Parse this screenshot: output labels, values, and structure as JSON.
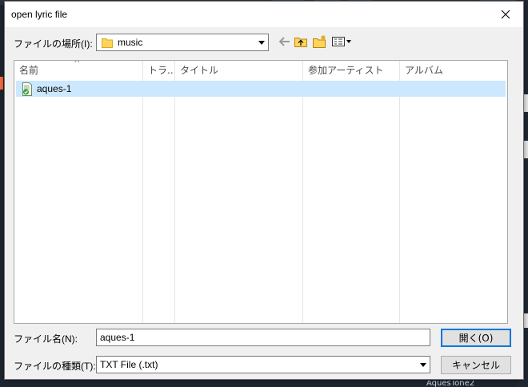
{
  "window": {
    "title": "open lyric file",
    "close_glyph": "close-icon"
  },
  "look_in": {
    "label": "ファイルの場所(I):",
    "value": "music",
    "icon": "folder-icon"
  },
  "toolbar": {
    "buttons": [
      "back-arrow-icon",
      "up-folder-icon",
      "new-folder-icon",
      "view-menu-icon"
    ]
  },
  "file_list": {
    "columns": [
      "名前",
      "トラ...",
      "タイトル",
      "参加アーティスト",
      "アルバム"
    ],
    "rows": [
      {
        "name": "aques-1",
        "selected": true,
        "icon": "text-file-icon"
      }
    ]
  },
  "filename": {
    "label": "ファイル名(N):",
    "value": "aques-1"
  },
  "filetype": {
    "label": "ファイルの種類(T):",
    "value": "TXT File (.txt)"
  },
  "buttons": {
    "open": "開く(O)",
    "cancel": "キャンセル"
  },
  "background": {
    "bottom_label": "AquesTone2"
  },
  "colors": {
    "selection": "#cce8ff",
    "accent": "#0078d7",
    "dialog_bg": "#f0f0f0"
  }
}
